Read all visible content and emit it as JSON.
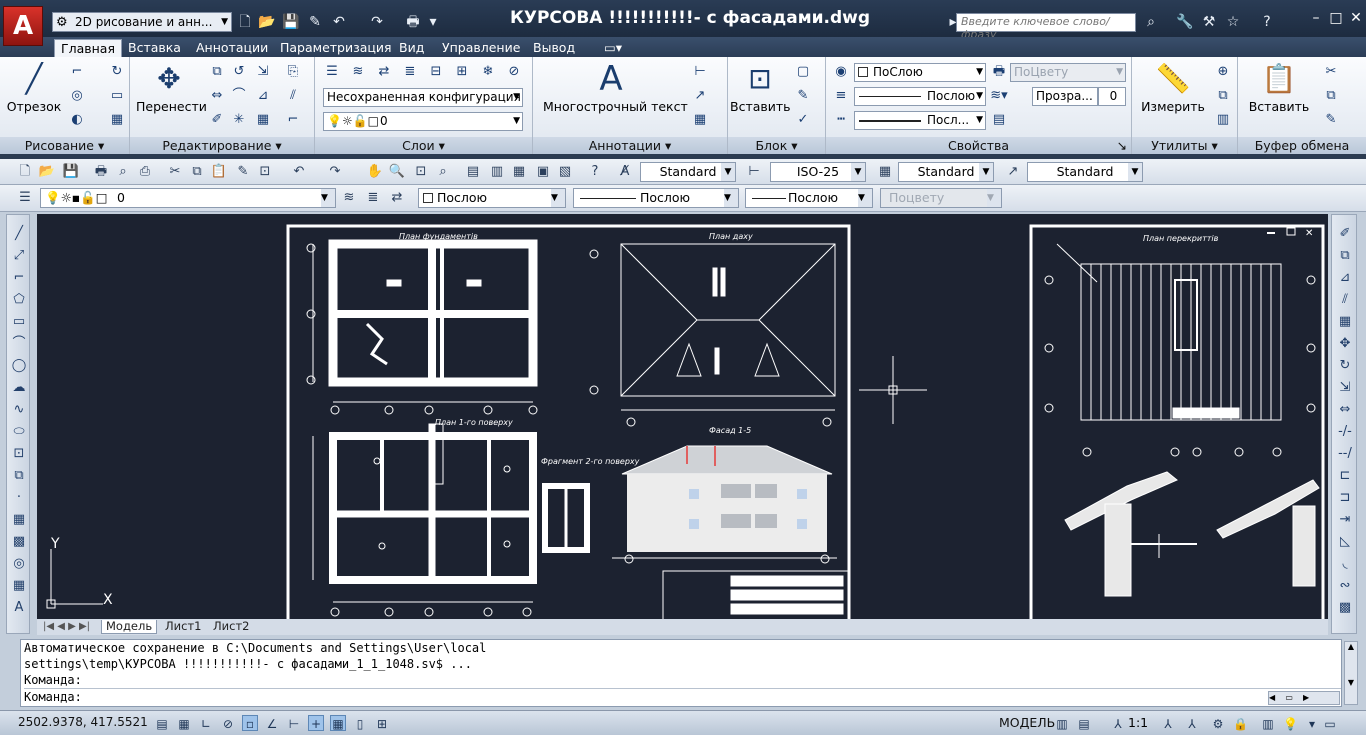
{
  "titlebar": {
    "logo": "A",
    "workspace": "2D рисование и анн...",
    "title": "КУРСОВА !!!!!!!!!!!- с фасадами.dwg",
    "search_placeholder": "Введите ключевое слово/фразу"
  },
  "tabs": [
    "Главная",
    "Вставка",
    "Аннотации",
    "Параметризация",
    "Вид",
    "Управление",
    "Вывод"
  ],
  "ribbon": {
    "draw": {
      "title": "Рисование",
      "line": "Отрезок"
    },
    "modify": {
      "title": "Редактирование",
      "move": "Перенести"
    },
    "layers": {
      "title": "Слои",
      "state": "Несохраненная конфигурация",
      "current": "0"
    },
    "annotation": {
      "title": "Аннотации",
      "mtext": "Многострочный текст"
    },
    "block": {
      "title": "Блок",
      "insert": "Вставить"
    },
    "properties": {
      "title": "Свойства",
      "color": "ПоСлою",
      "plot_style": "ПоЦвету",
      "linetype": "Послою",
      "lineweight": "Посл...",
      "transparency": "Прозра...",
      "transparency_value": "0"
    },
    "utilities": {
      "title": "Утилиты",
      "measure": "Измерить"
    },
    "clipboard": {
      "title": "Буфер обмена",
      "paste": "Вставить"
    }
  },
  "toolbar1": {
    "text_style": "Standard",
    "dim_style": "ISO-25",
    "table_style": "Standard",
    "mleader_style": "Standard"
  },
  "toolbar2": {
    "layer": "0",
    "color": "Послою",
    "linetype": "Послою",
    "lineweight": "Послою",
    "plot_style": "Поцвету"
  },
  "drawing": {
    "sheet1": {
      "foundation_plan": "План фундаментів",
      "roof_plan": "План даху",
      "floor1_plan": "План 1-го поверху",
      "fragment": "Фрагмент 2-го поверху",
      "facade": "Фасад 1-5"
    },
    "sheet2": {
      "title": "План перекриттів"
    },
    "ucs": {
      "x": "X",
      "y": "Y"
    }
  },
  "layout_tabs": [
    "Модель",
    "Лист1",
    "Лист2"
  ],
  "command": {
    "lines": [
      "Автоматическое сохранение в C:\\Documents and Settings\\User\\local",
      "settings\\temp\\КУРСОВА !!!!!!!!!!!- с фасадами_1_1_1048.sv$ ...",
      "Команда:"
    ],
    "prompt": "Команда:"
  },
  "status": {
    "coords": "2502.9378, 417.5521",
    "space": "МОДЕЛЬ",
    "scale": "1:1"
  },
  "colors": {
    "drawing_bg": "#1c2230",
    "ribbon_accent": "#2b3d56"
  }
}
